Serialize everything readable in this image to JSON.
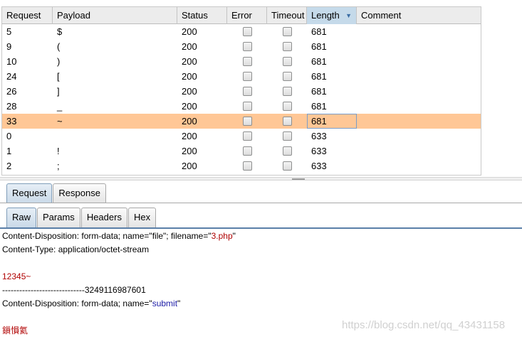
{
  "table": {
    "headers": [
      "Request",
      "Payload",
      "Status",
      "Error",
      "Timeout",
      "Length",
      "Comment"
    ],
    "sort_indicator": "▼",
    "rows": [
      {
        "request": "5",
        "payload": "$",
        "status": "200",
        "length": "681"
      },
      {
        "request": "9",
        "payload": "(",
        "status": "200",
        "length": "681"
      },
      {
        "request": "10",
        "payload": ")",
        "status": "200",
        "length": "681"
      },
      {
        "request": "24",
        "payload": "[",
        "status": "200",
        "length": "681"
      },
      {
        "request": "26",
        "payload": "]",
        "status": "200",
        "length": "681"
      },
      {
        "request": "28",
        "payload": "_",
        "status": "200",
        "length": "681"
      },
      {
        "request": "33",
        "payload": "~",
        "status": "200",
        "length": "681"
      },
      {
        "request": "0",
        "payload": "",
        "status": "200",
        "length": "633"
      },
      {
        "request": "1",
        "payload": "!",
        "status": "200",
        "length": "633"
      },
      {
        "request": "2",
        "payload": ";",
        "status": "200",
        "length": "633"
      }
    ],
    "selected_color": "#ffc796"
  },
  "tabs_top": [
    "Request",
    "Response"
  ],
  "tabs_sub": [
    "Raw",
    "Params",
    "Headers",
    "Hex"
  ],
  "body": {
    "line1_a": "Content-Disposition: form-data; name=\"file\"; filename=\"",
    "line1_b": "3.php",
    "line1_c": "\"",
    "line2": "Content-Type: application/octet-stream",
    "line4": "12345~",
    "line5": "-----------------------------3249116987601",
    "line6_a": "Content-Disposition: form-data; name=\"",
    "line6_b": "submit",
    "line6_c": "\"",
    "line8": "鎻愪氦"
  },
  "watermark": "https://blog.csdn.net/qq_43431158"
}
